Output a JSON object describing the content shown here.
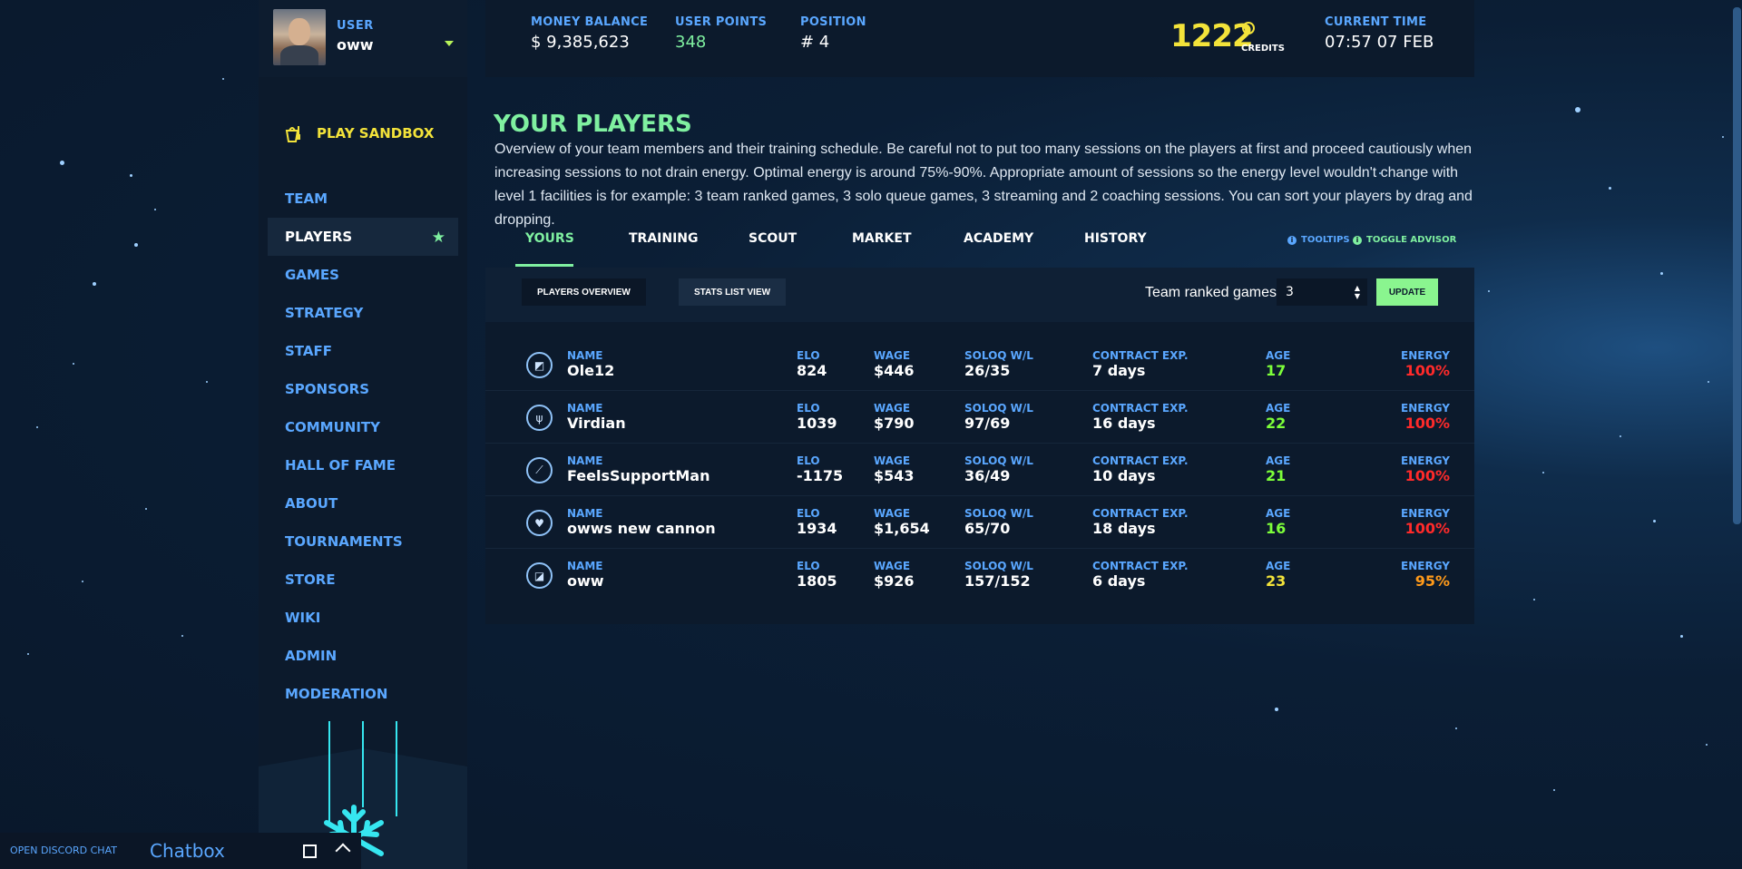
{
  "user": {
    "label": "USER",
    "name": "oww"
  },
  "sidebar": {
    "sandbox_label": "PLAY SANDBOX",
    "items": [
      {
        "label": "TEAM",
        "active": false
      },
      {
        "label": "PLAYERS",
        "active": true
      },
      {
        "label": "GAMES",
        "active": false
      },
      {
        "label": "STRATEGY",
        "active": false
      },
      {
        "label": "STAFF",
        "active": false
      },
      {
        "label": "SPONSORS",
        "active": false
      },
      {
        "label": "COMMUNITY",
        "active": false
      },
      {
        "label": "HALL OF FAME",
        "active": false
      },
      {
        "label": "ABOUT",
        "active": false
      },
      {
        "label": "TOURNAMENTS",
        "active": false
      },
      {
        "label": "STORE",
        "active": false
      },
      {
        "label": "WIKI",
        "active": false
      },
      {
        "label": "ADMIN",
        "active": false
      },
      {
        "label": "MODERATION",
        "active": false
      }
    ]
  },
  "header": {
    "money_label": "MONEY BALANCE",
    "money_value": "$ 9,385,623",
    "points_label": "USER POINTS",
    "points_value": "348",
    "position_label": "POSITION",
    "position_value": "# 4",
    "credits_value": "1222",
    "credits_label": "CREDITS",
    "time_label": "CURRENT TIME",
    "time_value": "07:57 07 FEB"
  },
  "main": {
    "title": "YOUR PLAYERS",
    "description": "Overview of your team members and their training schedule. Be careful not to put too many sessions on the players at first and proceed cautiously when increasing sessions to not drain energy. Optimal energy is around 75%-90%. Appropriate amount of sessions so the energy level wouldn't change with level 1 facilities is for example: 3 team ranked games, 3 solo queue games, 3 streaming and 2 coaching sessions. You can sort your players by drag and dropping.",
    "tabs": [
      {
        "label": "YOURS",
        "active": true
      },
      {
        "label": "TRAINING",
        "active": false
      },
      {
        "label": "SCOUT",
        "active": false
      },
      {
        "label": "MARKET",
        "active": false
      },
      {
        "label": "ACADEMY",
        "active": false
      },
      {
        "label": "HISTORY",
        "active": false
      }
    ],
    "tooltips_label": "TOOLTIPS",
    "advisor_label": "TOGGLE ADVISOR",
    "view_buttons": {
      "overview": "PLAYERS OVERVIEW",
      "stats": "STATS LIST VIEW"
    },
    "ranked": {
      "label": "Team ranked games:",
      "value": "3",
      "update_label": "UPDATE"
    },
    "columns": {
      "name": "NAME",
      "elo": "ELO",
      "wage": "WAGE",
      "soloq": "SOLOQ W/L",
      "contract": "CONTRACT EXP.",
      "age": "AGE",
      "energy": "ENERGY"
    },
    "players": [
      {
        "role_icon": "top-lane-icon",
        "glyph": "◩",
        "name": "Ole12",
        "elo": "824",
        "wage": "$446",
        "soloq": "26/35",
        "contract": "7 days",
        "age": "17",
        "age_color": "green",
        "energy": "100%",
        "energy_color": "red"
      },
      {
        "role_icon": "jungle-icon",
        "glyph": "ψ",
        "name": "Virdian",
        "elo": "1039",
        "wage": "$790",
        "soloq": "97/69",
        "contract": "16 days",
        "age": "22",
        "age_color": "green",
        "energy": "100%",
        "energy_color": "red"
      },
      {
        "role_icon": "mid-lane-icon",
        "glyph": "⟋",
        "name": "FeelsSupportMan",
        "elo": "-1175",
        "wage": "$543",
        "soloq": "36/49",
        "contract": "10 days",
        "age": "21",
        "age_color": "green",
        "energy": "100%",
        "energy_color": "red"
      },
      {
        "role_icon": "support-heart-icon",
        "glyph": "♥",
        "name": "owws new cannon",
        "elo": "1934",
        "wage": "$1,654",
        "soloq": "65/70",
        "contract": "18 days",
        "age": "16",
        "age_color": "green",
        "energy": "100%",
        "energy_color": "red"
      },
      {
        "role_icon": "bot-lane-icon",
        "glyph": "◪",
        "name": "oww",
        "elo": "1805",
        "wage": "$926",
        "soloq": "157/152",
        "contract": "6 days",
        "age": "23",
        "age_color": "yellow",
        "energy": "95%",
        "energy_color": "orange"
      }
    ]
  },
  "chat": {
    "open_label": "OPEN DISCORD CHAT",
    "title": "Chatbox"
  },
  "colors": {
    "accent_green": "#7ff0a0",
    "link_blue": "#5aa7ff",
    "credits_yellow": "#f3e33a",
    "energy_red": "#ff2a2a",
    "energy_orange": "#ff9a1a"
  }
}
